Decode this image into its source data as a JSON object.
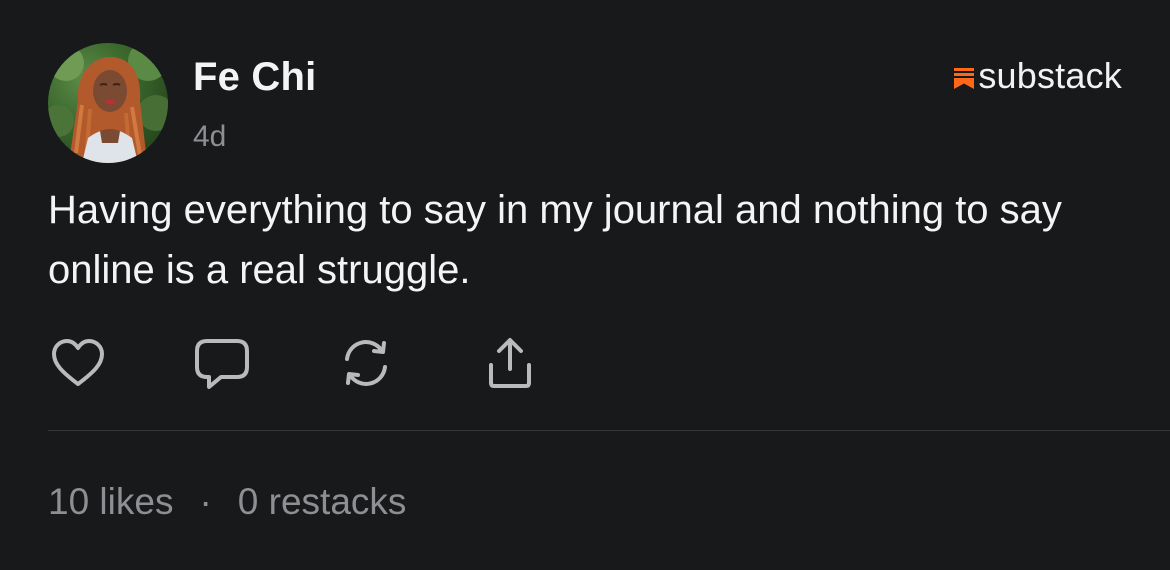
{
  "note": {
    "author": "Fe Chi",
    "time": "4d",
    "brand": "substack",
    "text": "Having everything to say in my journal and nothing to say online is a real struggle.",
    "actions": {
      "like_icon": "heart-icon",
      "comment_icon": "comment-icon",
      "restack_icon": "restack-icon",
      "share_icon": "share-icon"
    },
    "stats": {
      "likes": "10 likes",
      "separator": "·",
      "restacks": "0 restacks"
    }
  },
  "colors": {
    "background": "#17191b",
    "text": "#f4f4f4",
    "muted": "#8e8f92",
    "icon": "#b9babc",
    "brand_accent": "#ff6719",
    "divider": "#34363a"
  }
}
